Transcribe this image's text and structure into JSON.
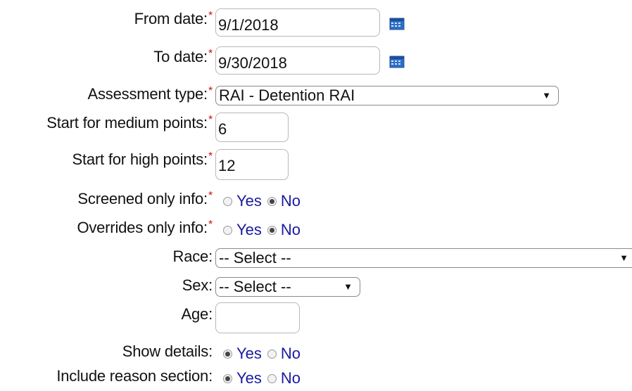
{
  "required_mark": "*",
  "from_date": {
    "label": "From date:",
    "value": "9/1/2018"
  },
  "to_date": {
    "label": "To date:",
    "value": "9/30/2018"
  },
  "assessment_type": {
    "label": "Assessment type:",
    "value": "RAI - Detention RAI"
  },
  "medium_points": {
    "label": "Start for medium points:",
    "value": "6"
  },
  "high_points": {
    "label": "Start for high points:",
    "value": "12"
  },
  "screened_only": {
    "label": "Screened only info:",
    "yes": "Yes",
    "no": "No",
    "selected": "No"
  },
  "overrides_only": {
    "label": "Overrides only info:",
    "yes": "Yes",
    "no": "No",
    "selected": "No"
  },
  "race": {
    "label": "Race:",
    "value": "-- Select --"
  },
  "sex": {
    "label": "Sex:",
    "value": "-- Select --"
  },
  "age": {
    "label": "Age:",
    "value": ""
  },
  "show_details": {
    "label": "Show details:",
    "yes": "Yes",
    "no": "No",
    "selected": "Yes"
  },
  "include_reason": {
    "label": "Include reason section:",
    "yes": "Yes",
    "no": "No",
    "selected": "Yes"
  },
  "icons": {
    "calendar": "calendar-icon",
    "dropdown": "chevron-down-icon"
  },
  "colors": {
    "required": "#cc1111",
    "radio_label": "#1a1aa0"
  }
}
